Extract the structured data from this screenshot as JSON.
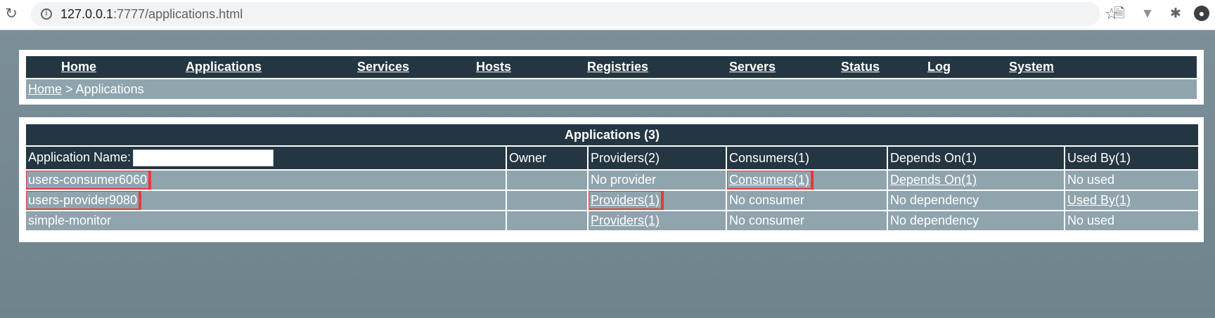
{
  "browser": {
    "url_host": "127.0.0.1",
    "url_rest": ":7777/applications.html"
  },
  "menu": [
    {
      "label": "Home"
    },
    {
      "label": "Applications"
    },
    {
      "label": "Services"
    },
    {
      "label": "Hosts"
    },
    {
      "label": "Registries"
    },
    {
      "label": "Servers"
    },
    {
      "label": "Status"
    },
    {
      "label": "Log"
    },
    {
      "label": "System"
    }
  ],
  "breadcrumb": {
    "home": "Home",
    "separator": " > ",
    "current": "Applications"
  },
  "table": {
    "title": "Applications (3)",
    "columns": {
      "name": "Application Name:",
      "owner": "Owner",
      "providers": "Providers(2)",
      "consumers": "Consumers(1)",
      "depends": "Depends On(1)",
      "used_by": "Used By(1)"
    },
    "search_value": "",
    "rows": [
      {
        "name": "users-consumer6060",
        "owner": "",
        "providers": "No provider",
        "consumers": "Consumers(1)",
        "depends": "Depends On(1)",
        "used_by": "No used"
      },
      {
        "name": "users-provider9080",
        "owner": "",
        "providers": "Providers(1)",
        "consumers": "No consumer",
        "depends": "No dependency",
        "used_by": "Used By(1)"
      },
      {
        "name": "simple-monitor",
        "owner": "",
        "providers": "Providers(1)",
        "consumers": "No consumer",
        "depends": "No dependency",
        "used_by": "No used"
      }
    ]
  },
  "colors": {
    "header": "#233642",
    "row": "#8fa4ad",
    "highlight": "#e8383d",
    "link_blue": "#0000ee"
  }
}
